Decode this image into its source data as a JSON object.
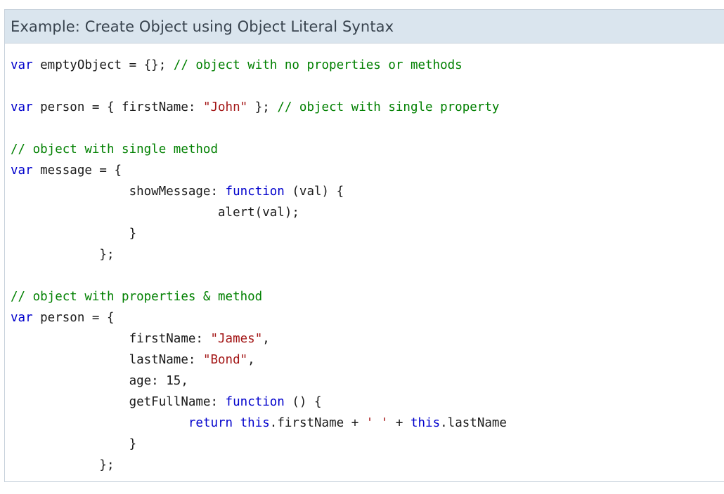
{
  "example": {
    "title": "Example: Create Object using Object Literal Syntax"
  },
  "code": {
    "lines": [
      [
        [
          "kw",
          "var"
        ],
        [
          "p",
          " emptyObject = {}; "
        ],
        [
          "cm",
          "// object with no properties or methods"
        ]
      ],
      [],
      [
        [
          "kw",
          "var"
        ],
        [
          "p",
          " person = { firstName: "
        ],
        [
          "str",
          "\"John\""
        ],
        [
          "p",
          " }; "
        ],
        [
          "cm",
          "// object with single property"
        ]
      ],
      [],
      [
        [
          "cm",
          "// object with single method"
        ]
      ],
      [
        [
          "kw",
          "var"
        ],
        [
          "p",
          " message = {"
        ]
      ],
      [
        [
          "p",
          "                showMessage: "
        ],
        [
          "kw",
          "function"
        ],
        [
          "p",
          " (val) {"
        ]
      ],
      [
        [
          "p",
          "                            alert(val);"
        ]
      ],
      [
        [
          "p",
          "                }"
        ]
      ],
      [
        [
          "p",
          "            };"
        ]
      ],
      [],
      [
        [
          "cm",
          "// object with properties & method"
        ]
      ],
      [
        [
          "kw",
          "var"
        ],
        [
          "p",
          " person = {"
        ]
      ],
      [
        [
          "p",
          "                firstName: "
        ],
        [
          "str",
          "\"James\""
        ],
        [
          "p",
          ","
        ]
      ],
      [
        [
          "p",
          "                lastName: "
        ],
        [
          "str",
          "\"Bond\""
        ],
        [
          "p",
          ","
        ]
      ],
      [
        [
          "p",
          "                age: 15,"
        ]
      ],
      [
        [
          "p",
          "                getFullName: "
        ],
        [
          "kw",
          "function"
        ],
        [
          "p",
          " () {"
        ]
      ],
      [
        [
          "p",
          "                        "
        ],
        [
          "kw",
          "return"
        ],
        [
          "p",
          " "
        ],
        [
          "kw",
          "this"
        ],
        [
          "p",
          ".firstName + "
        ],
        [
          "str",
          "' '"
        ],
        [
          "p",
          " + "
        ],
        [
          "kw",
          "this"
        ],
        [
          "p",
          ".lastName"
        ]
      ],
      [
        [
          "p",
          "                }"
        ]
      ],
      [
        [
          "p",
          "            };"
        ]
      ]
    ]
  }
}
